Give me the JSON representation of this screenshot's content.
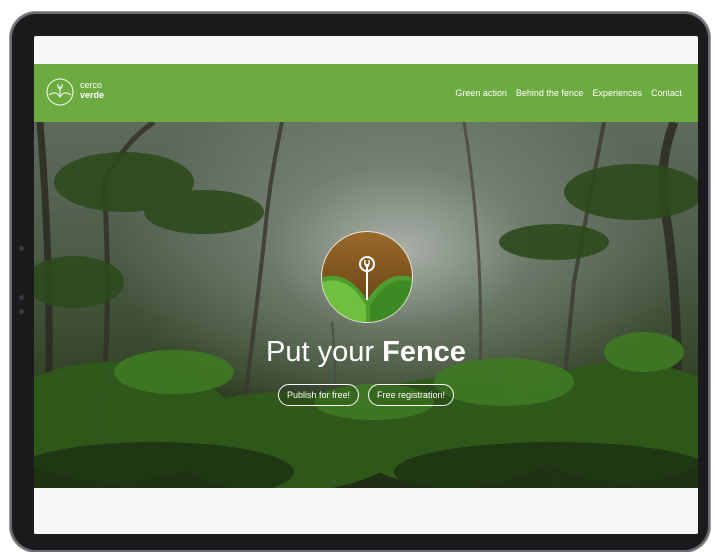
{
  "brand": {
    "line1": "cerco",
    "line2": "verde",
    "accent": "#6cab3f"
  },
  "nav": {
    "items": [
      {
        "label": "Green action"
      },
      {
        "label": "Behind the fence"
      },
      {
        "label": "Experiences"
      },
      {
        "label": "Contact"
      }
    ]
  },
  "hero": {
    "headline_light": "Put your",
    "headline_bold": "Fence",
    "buttons": [
      {
        "label": "Publish for free!"
      },
      {
        "label": "Free registration!"
      }
    ]
  },
  "icons": {
    "logo": "sprout-circle-icon",
    "hero_logo": "sprout-emblem-icon"
  }
}
